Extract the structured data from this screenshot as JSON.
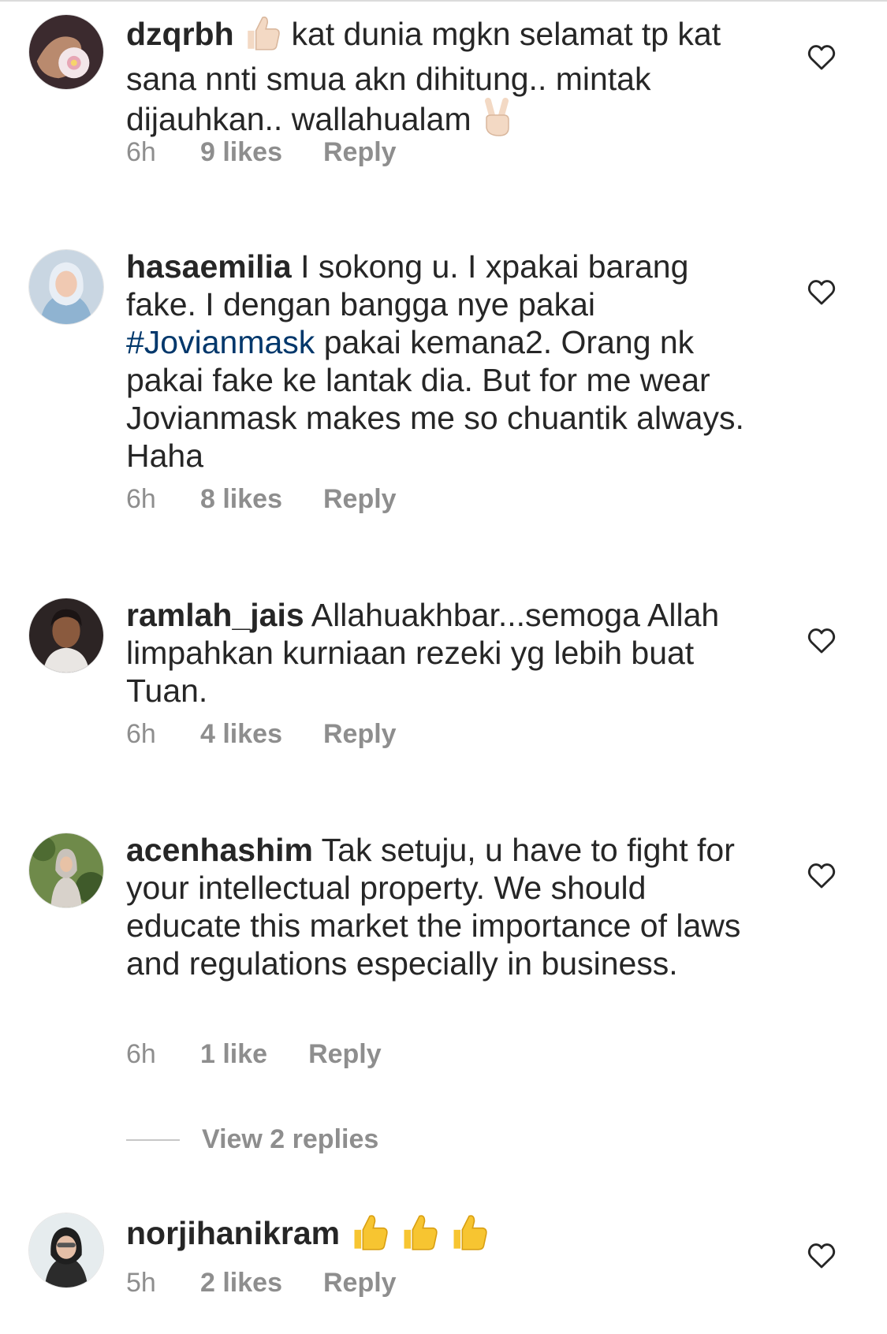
{
  "comments": [
    {
      "username": "dzqrbh",
      "text_1": "kat dunia mgkn selamat tp kat sana nnti smua akn dihitung.. mintak dijauhkan.. wallahualam",
      "time": "6h",
      "likes": "9 likes",
      "reply": "Reply",
      "emojis": [
        "thumbs-up",
        "victory-hand"
      ]
    },
    {
      "username": "hasaemilia",
      "text_1": "I sokong u. I xpakai barang fake. I dengan bangga nye pakai",
      "hashtag": "#Jovianmask",
      "text_2": "pakai kemana2. Orang nk pakai fake ke lantak dia. But for me wear Jovianmask makes me so chuantik always. Haha",
      "time": "6h",
      "likes": "8 likes",
      "reply": "Reply"
    },
    {
      "username": "ramlah_jais",
      "text_1": "Allahuakhbar...semoga Allah limpahkan kurniaan rezeki yg lebih buat Tuan.",
      "time": "6h",
      "likes": "4 likes",
      "reply": "Reply"
    },
    {
      "username": "acenhashim",
      "text_1": "Tak setuju, u have to fight for your intellectual property. We should educate this market the importance of laws and regulations especially in business.",
      "time": "6h",
      "likes": "1 like",
      "reply": "Reply",
      "view_replies": "View 2 replies"
    },
    {
      "username": "norjihanikram",
      "text_1": "",
      "time": "5h",
      "likes": "2 likes",
      "reply": "Reply",
      "emojis": [
        "thumbs-up",
        "thumbs-up",
        "thumbs-up"
      ]
    }
  ],
  "colors": {
    "text": "#262626",
    "meta": "#8e8e8e",
    "hashtag": "#00376b",
    "heart": "#262626"
  }
}
